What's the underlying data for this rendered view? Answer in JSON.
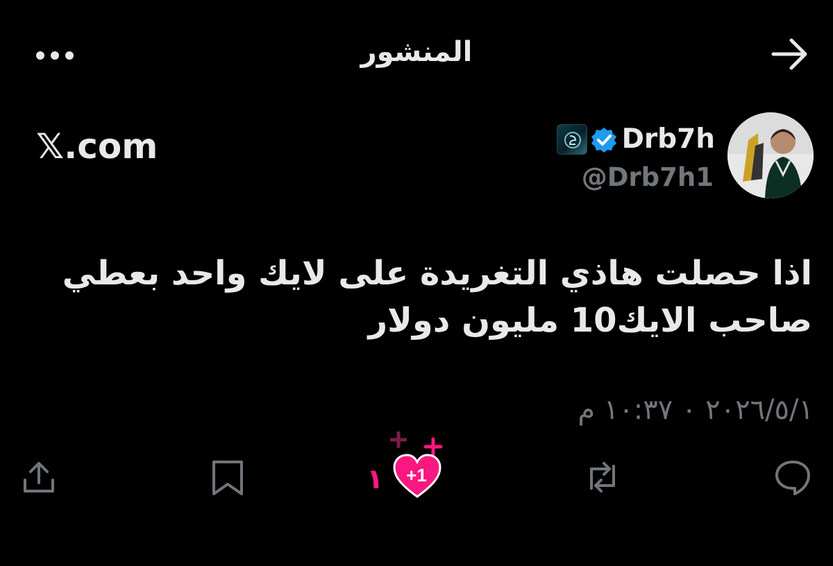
{
  "header": {
    "title": "المنشور",
    "more_icon": "more-horizontal-icon",
    "back_icon": "arrow-right-icon"
  },
  "author": {
    "display_name": "Drb7h",
    "handle": "@Drb7h1",
    "verified_icon": "verified-badge-icon",
    "verified_color": "#1d9bf0"
  },
  "source_label": "𝕏.com",
  "tweet": {
    "text": "اذا حصلت هاذي التغريدة على لايك واحد بعطي صاحب الايك10 مليون دولار",
    "timestamp": "٢٠٢٦/٥/١ ٠ ١٠:٣٧ م"
  },
  "actions": {
    "reply_icon": "reply-icon",
    "retweet_icon": "retweet-icon",
    "like_icon": "heart-icon",
    "like_count": "١",
    "like_overlay": "+1",
    "bookmark_icon": "bookmark-icon",
    "share_icon": "share-icon",
    "like_color": "#f91880"
  },
  "colors": {
    "background": "#000000",
    "text_primary": "#e7e9ea",
    "text_secondary": "#71767b"
  }
}
